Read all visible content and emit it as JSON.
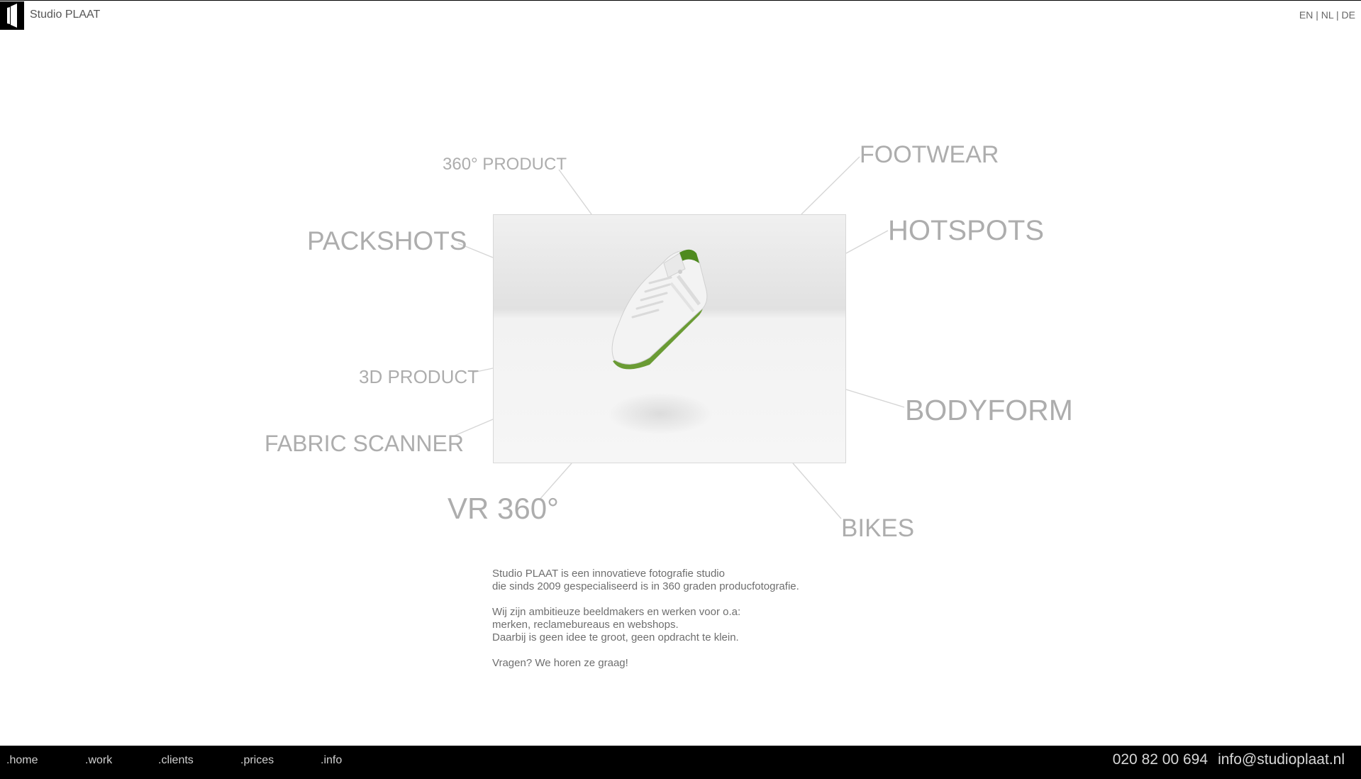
{
  "header": {
    "logo": "studio-plaat-logo",
    "title": "Studio PLAAT",
    "languages": [
      "EN",
      "NL",
      "DE"
    ],
    "language_separator": " | "
  },
  "categories": {
    "product360": "360° PRODUCT",
    "footwear": "FOOTWEAR",
    "packshots": "PACKSHOTS",
    "hotspots": "HOTSPOTS",
    "product3d": "3D PRODUCT",
    "bodyform": "BODYFORM",
    "fabric_scanner": "FABRIC SCANNER",
    "vr360": "VR 360°",
    "bikes": "BIKES"
  },
  "stage": {
    "image": "white-sneaker-green-sole"
  },
  "intro": {
    "p1_line1": "Studio PLAAT is een innovatieve fotografie studio",
    "p1_line2": "die sinds 2009 gespecialiseerd is in 360 graden producfotografie.",
    "p2_line1": "Wij zijn ambitieuze beeldmakers en werken voor o.a:",
    "p2_line2": "merken, reclamebureaus en webshops.",
    "p2_line3": "Daarbij is geen idee te groot, geen opdracht te klein.",
    "p3_line1": "Vragen? We horen ze graag!"
  },
  "footer": {
    "nav": [
      ".home",
      ".work",
      ".clients",
      ".prices",
      ".info"
    ],
    "phone": "020 82 00 694",
    "email": "info@studioplaat.nl"
  },
  "colors": {
    "label_gray": "#adadad",
    "footer_bg": "#000000",
    "sole_green": "#6a9b34"
  }
}
